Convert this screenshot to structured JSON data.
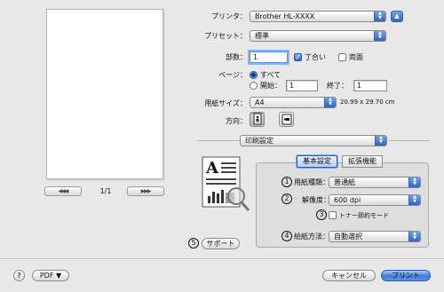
{
  "preview": {
    "page_counter": "1/1",
    "first_page": "◀◀",
    "prev_page": "◀",
    "next_page": "▶",
    "last_page": "▶▶"
  },
  "printer": {
    "label": "プリンタ：",
    "value": "Brother HL-XXXX"
  },
  "preset": {
    "label": "プリセット：",
    "value": "標準"
  },
  "copies": {
    "label": "部数：",
    "value": "1",
    "collate_label": "丁合い",
    "collate_checked": true,
    "duplex_label": "両面",
    "duplex_checked": false
  },
  "pages": {
    "label": "ページ：",
    "all_label": "すべて",
    "from_label": "開始：",
    "from_value": "1",
    "to_label": "終了：",
    "to_value": "1",
    "selected": "all"
  },
  "paper_size": {
    "label": "用紙サイズ：",
    "value": "A4",
    "dimensions": "20.99 x 29.70 cm"
  },
  "orientation": {
    "label": "方向：",
    "selected": "portrait"
  },
  "panel_select": {
    "value": "印刷設定"
  },
  "tabs": [
    {
      "label": "基本設定",
      "active": true
    },
    {
      "label": "拡張機能",
      "active": false
    }
  ],
  "settings": {
    "media_type": {
      "num": "1",
      "label": "用紙種類：",
      "value": "普通紙"
    },
    "resolution": {
      "num": "2",
      "label": "解像度：",
      "value": "600 dpi"
    },
    "toner_save": {
      "num": "3",
      "label": "トナー節約モード",
      "checked": false
    },
    "paper_source": {
      "num": "4",
      "label": "給紙方法：",
      "value": "自動選択"
    }
  },
  "support": {
    "num": "5",
    "label": "サポート"
  },
  "footer": {
    "help": "?",
    "pdf_label": "PDF ▼",
    "cancel_label": "キャンセル",
    "print_label": "プリント"
  }
}
